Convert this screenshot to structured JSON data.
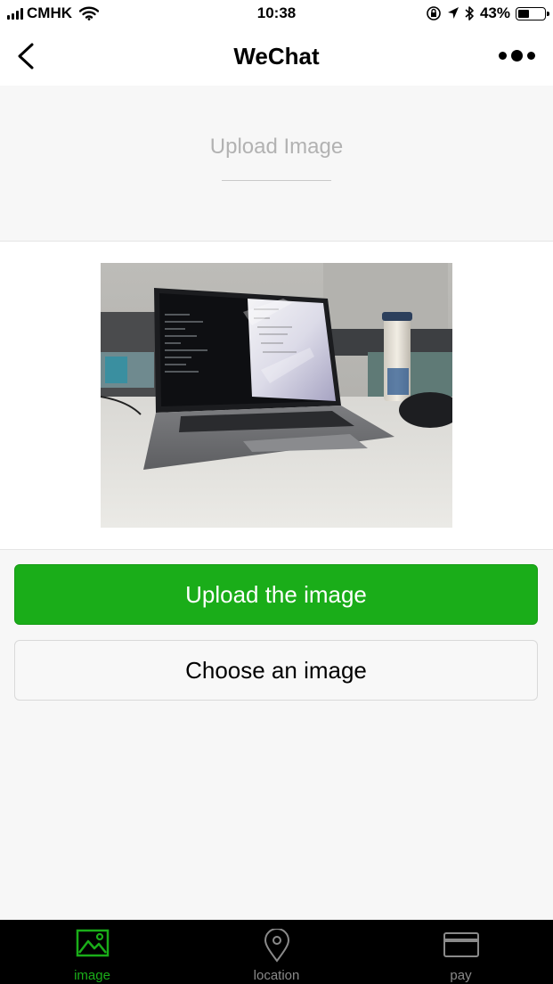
{
  "status_bar": {
    "carrier": "CMHK",
    "time": "10:38",
    "battery_percent": "43%",
    "battery_level": 0.43
  },
  "nav": {
    "title": "WeChat"
  },
  "header": {
    "title": "Upload Image"
  },
  "buttons": {
    "upload": "Upload the image",
    "choose": "Choose an image"
  },
  "tabs": [
    {
      "label": "image",
      "icon": "image-icon",
      "active": true
    },
    {
      "label": "location",
      "icon": "location-pin-icon",
      "active": false
    },
    {
      "label": "pay",
      "icon": "card-icon",
      "active": false
    }
  ],
  "colors": {
    "primary": "#1aad19",
    "tab_bar": "#000000",
    "background": "#f7f7f7"
  }
}
